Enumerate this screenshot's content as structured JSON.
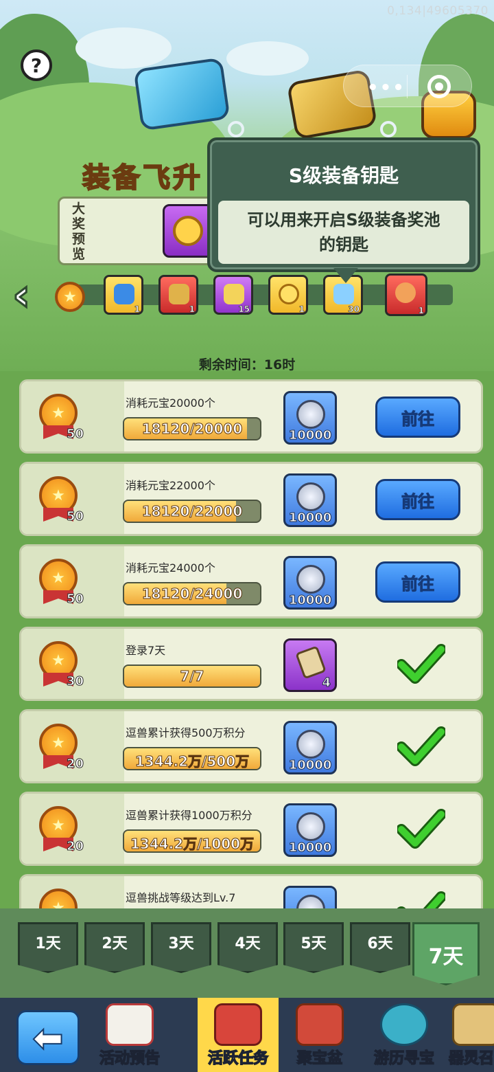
{
  "watermark": "0,134|49605370",
  "help": {
    "icon": "question-mark-icon",
    "label": "?"
  },
  "capsule": {
    "more_label": "•••"
  },
  "title": "装备飞升",
  "preview": {
    "label": "大奖预览"
  },
  "tooltip": {
    "title": "S级装备钥匙",
    "body_line1": "可以用来开启S级装备奖池",
    "body_line2": "的钥匙"
  },
  "reward_track": {
    "back_icon": "chevron-left-icon",
    "items": [
      {
        "icon": "equipment-chest-icon",
        "count": "1"
      },
      {
        "icon": "armor-pack-icon",
        "count": "1"
      },
      {
        "icon": "purple-key-icon",
        "count": "15"
      },
      {
        "icon": "gold-coin-icon",
        "count": "1"
      },
      {
        "icon": "s-key-icon",
        "count": "30"
      },
      {
        "icon": "treasure-bag-icon",
        "count": "1"
      }
    ]
  },
  "remaining_time": "剩余时间：16时",
  "tasks": [
    {
      "points": "50",
      "title": "消耗元宝20000个",
      "progress": "18120/20000",
      "progress_value": 0.906,
      "reward_icon": "silver-coin-icon",
      "reward_count": "10000",
      "action": "前往",
      "done": false
    },
    {
      "points": "50",
      "title": "消耗元宝22000个",
      "progress": "18120/22000",
      "progress_value": 0.824,
      "reward_icon": "silver-coin-icon",
      "reward_count": "10000",
      "action": "前往",
      "done": false
    },
    {
      "points": "50",
      "title": "消耗元宝24000个",
      "progress": "18120/24000",
      "progress_value": 0.755,
      "reward_icon": "silver-coin-icon",
      "reward_count": "10000",
      "action": "前往",
      "done": false
    },
    {
      "points": "30",
      "title": "登录7天",
      "progress": "7/7",
      "progress_value": 1.0,
      "reward_icon": "scroll-icon",
      "reward_count": "4",
      "action": "",
      "done": true
    },
    {
      "points": "20",
      "title": "逗兽累计获得500万积分",
      "progress": "1344.2万/500万",
      "progress_value": 1.0,
      "reward_icon": "silver-coin-icon",
      "reward_count": "10000",
      "action": "",
      "done": true
    },
    {
      "points": "20",
      "title": "逗兽累计获得1000万积分",
      "progress": "1344.2万/1000万",
      "progress_value": 1.0,
      "reward_icon": "silver-coin-icon",
      "reward_count": "10000",
      "action": "",
      "done": true
    },
    {
      "points": "",
      "title": "逗兽挑战等级达到Lv.7",
      "progress": "",
      "progress_value": 1.0,
      "reward_icon": "silver-coin-icon",
      "reward_count": "",
      "action": "",
      "done": true
    }
  ],
  "day_tabs": [
    "1天",
    "2天",
    "3天",
    "4天",
    "5天",
    "6天",
    "7天"
  ],
  "active_day": "7天",
  "bottom_nav": {
    "back_icon": "arrow-left-icon",
    "items": [
      {
        "icon": "calendar-icon",
        "label": "活动预告"
      },
      {
        "icon": "active-task-icon",
        "label": "活跃任务"
      },
      {
        "icon": "treasure-bowl-icon",
        "label": "聚宝盆"
      },
      {
        "icon": "explore-treasure-icon",
        "label": "游历寻宝"
      },
      {
        "icon": "artifact-spirit-icon",
        "label": "器灵召"
      }
    ]
  },
  "colors": {
    "go_button": "#2f7fe8",
    "check": "#3fcf2f",
    "tooltip_bg": "#3f5f4f",
    "nav_active": "#ffd84a"
  }
}
